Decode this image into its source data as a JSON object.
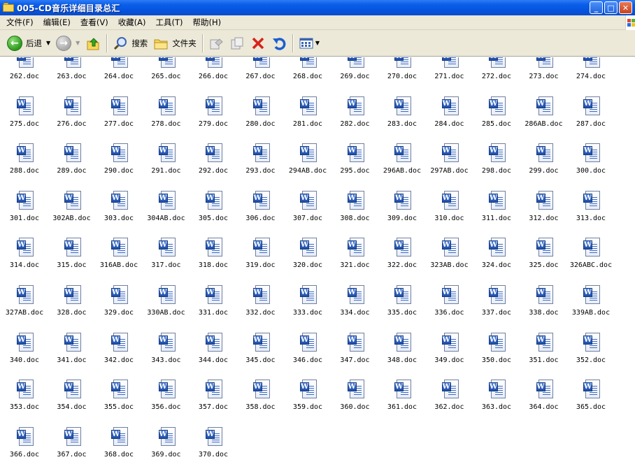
{
  "window": {
    "title": "005-CD音乐详细目录总汇",
    "minimize": "_",
    "maximize": "□",
    "close": "✕"
  },
  "menu": [
    "文件(F)",
    "编辑(E)",
    "查看(V)",
    "收藏(A)",
    "工具(T)",
    "帮助(H)"
  ],
  "toolbar": {
    "back_label": "后退",
    "search_label": "搜索",
    "folders_label": "文件夹"
  },
  "colors": {
    "titlebar": "#0553dd",
    "chrome": "#ece9d8",
    "word_blue": "#1f4ea8"
  },
  "icons": {
    "file_icon": "word-document-icon",
    "folder": "folder-icon",
    "back": "back-arrow-icon",
    "forward": "forward-arrow-icon",
    "up": "up-folder-icon",
    "search": "search-icon",
    "move": "move-to-icon",
    "copy": "copy-to-icon",
    "delete": "delete-icon",
    "undo": "undo-icon",
    "views": "views-icon"
  },
  "files": [
    "262.doc",
    "263.doc",
    "264.doc",
    "265.doc",
    "266.doc",
    "267.doc",
    "268.doc",
    "269.doc",
    "270.doc",
    "271.doc",
    "272.doc",
    "273.doc",
    "274.doc",
    "275.doc",
    "276.doc",
    "277.doc",
    "278.doc",
    "279.doc",
    "280.doc",
    "281.doc",
    "282.doc",
    "283.doc",
    "284.doc",
    "285.doc",
    "286AB.doc",
    "287.doc",
    "288.doc",
    "289.doc",
    "290.doc",
    "291.doc",
    "292.doc",
    "293.doc",
    "294AB.doc",
    "295.doc",
    "296AB.doc",
    "297AB.doc",
    "298.doc",
    "299.doc",
    "300.doc",
    "301.doc",
    "302AB.doc",
    "303.doc",
    "304AB.doc",
    "305.doc",
    "306.doc",
    "307.doc",
    "308.doc",
    "309.doc",
    "310.doc",
    "311.doc",
    "312.doc",
    "313.doc",
    "314.doc",
    "315.doc",
    "316AB.doc",
    "317.doc",
    "318.doc",
    "319.doc",
    "320.doc",
    "321.doc",
    "322.doc",
    "323AB.doc",
    "324.doc",
    "325.doc",
    "326ABC.doc",
    "327AB.doc",
    "328.doc",
    "329.doc",
    "330AB.doc",
    "331.doc",
    "332.doc",
    "333.doc",
    "334.doc",
    "335.doc",
    "336.doc",
    "337.doc",
    "338.doc",
    "339AB.doc",
    "340.doc",
    "341.doc",
    "342.doc",
    "343.doc",
    "344.doc",
    "345.doc",
    "346.doc",
    "347.doc",
    "348.doc",
    "349.doc",
    "350.doc",
    "351.doc",
    "352.doc",
    "353.doc",
    "354.doc",
    "355.doc",
    "356.doc",
    "357.doc",
    "358.doc",
    "359.doc",
    "360.doc",
    "361.doc",
    "362.doc",
    "363.doc",
    "364.doc",
    "365.doc",
    "366.doc",
    "367.doc",
    "368.doc",
    "369.doc",
    "370.doc"
  ]
}
